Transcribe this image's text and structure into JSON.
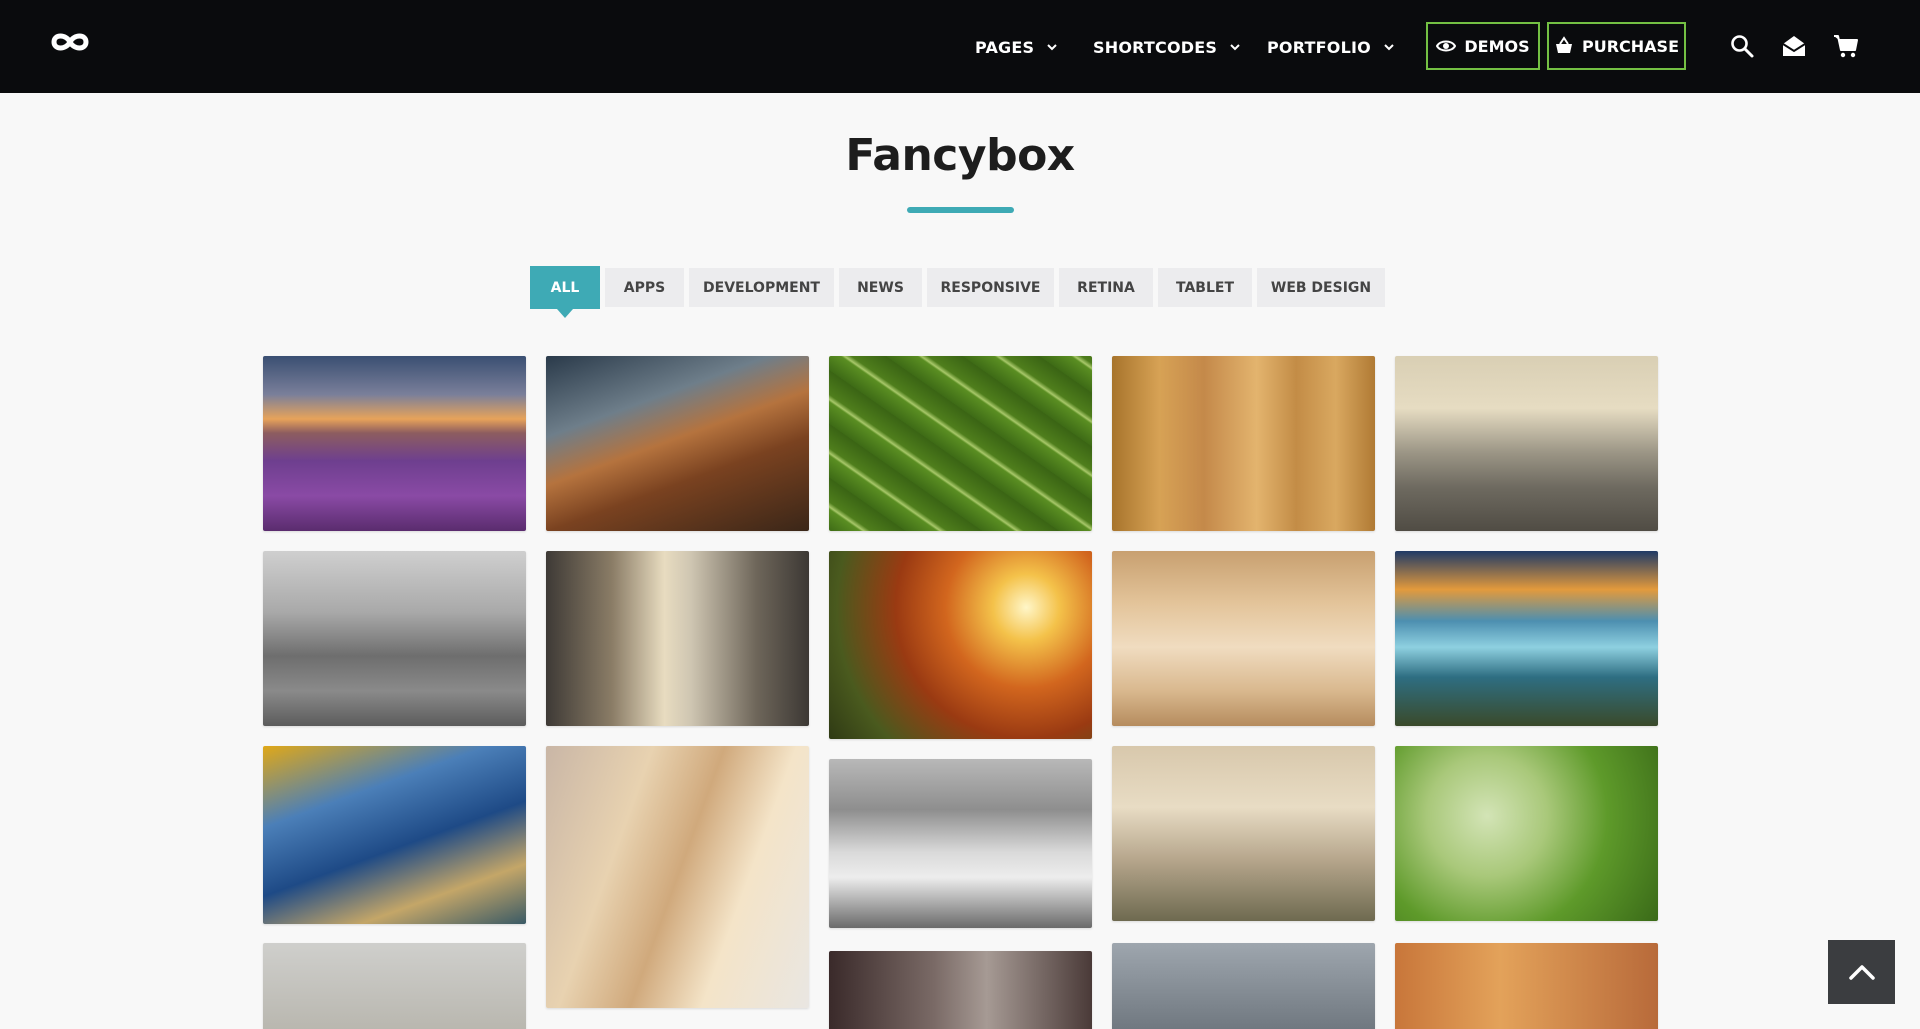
{
  "header": {
    "logo_icon": "infinity-logo-icon",
    "nav": [
      {
        "label": "PAGES"
      },
      {
        "label": "SHORTCODES"
      },
      {
        "label": "PORTFOLIO"
      }
    ],
    "demos_label": "DEMOS",
    "purchase_label": "PURCHASE",
    "accent_color": "#74c043",
    "icons": [
      "search-icon",
      "mail-icon",
      "cart-icon"
    ]
  },
  "main": {
    "title": "Fancybox",
    "accent_color": "#3eaab5",
    "filters": [
      {
        "label": "ALL",
        "active": true
      },
      {
        "label": "APPS",
        "active": false
      },
      {
        "label": "DEVELOPMENT",
        "active": false
      },
      {
        "label": "NEWS",
        "active": false
      },
      {
        "label": "RESPONSIVE",
        "active": false
      },
      {
        "label": "RETINA",
        "active": false
      },
      {
        "label": "TABLET",
        "active": false
      },
      {
        "label": "WEB DESIGN",
        "active": false
      }
    ]
  },
  "back_to_top_icon": "chevron-up-icon"
}
